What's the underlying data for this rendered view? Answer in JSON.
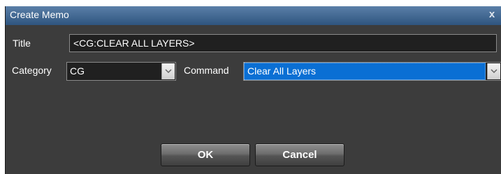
{
  "window": {
    "title": "Create Memo",
    "close_glyph": "x"
  },
  "form": {
    "title_label": "Title",
    "title_value": "<CG:CLEAR ALL LAYERS>",
    "category_label": "Category",
    "category_value": "CG",
    "command_label": "Command",
    "command_value": "Clear All Layers"
  },
  "buttons": {
    "ok_label": "OK",
    "cancel_label": "Cancel"
  },
  "colors": {
    "titlebar": "#2f557f",
    "panel": "#3c3c3c",
    "selection": "#0a6fd4"
  },
  "icons": {
    "close": "close-icon",
    "dropdown": "chevron-down-icon"
  }
}
